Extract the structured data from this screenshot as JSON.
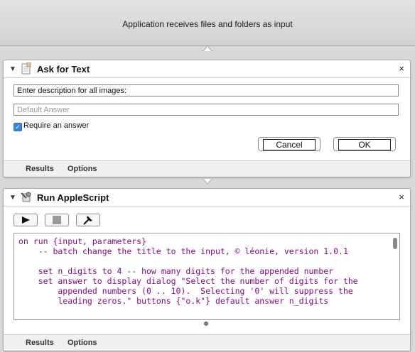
{
  "header": {
    "text": "Application receives files and folders as input"
  },
  "ask_text": {
    "title": "Ask for Text",
    "close": "×",
    "question_value": "Enter description for all images:",
    "default_placeholder": "Default Answer",
    "require_checked": true,
    "require_label": "Require an answer",
    "cancel_label": "Cancel",
    "ok_label": "OK",
    "tabs": [
      "Results",
      "Options"
    ]
  },
  "applescript": {
    "title": "Run AppleScript",
    "close": "×",
    "code": "on run {input, parameters}\n    -- batch change the title to the input, © léonie, version 1.0.1\n\n    set n_digits to 4 -- how many digits for the appended number\n    set answer to display dialog \"Select the number of digits for the\n        appended numbers (0 .. 10).  Selecting '0' will suppress the\n        leading zeros.\" buttons {\"o.k\"} default answer n_digits",
    "tabs": [
      "Results",
      "Options"
    ]
  }
}
